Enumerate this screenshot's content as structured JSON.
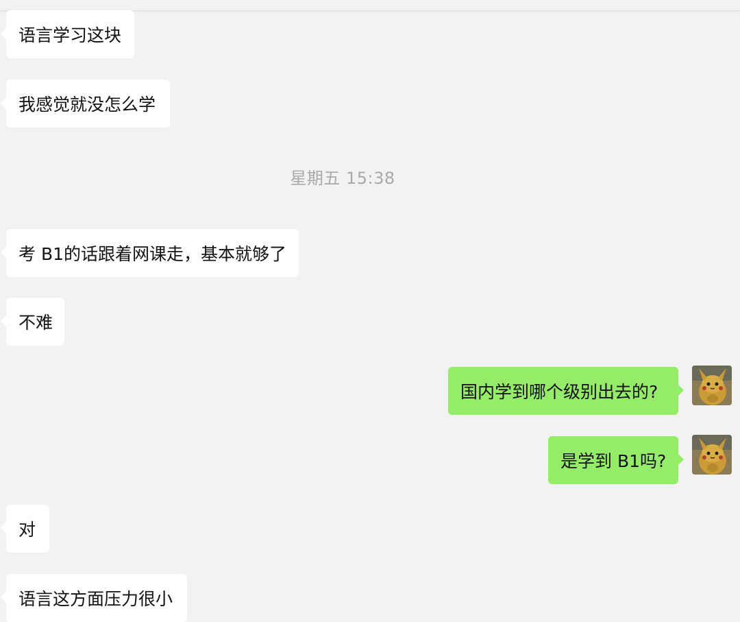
{
  "timestamp": "星期五 15:38",
  "messages": [
    {
      "text": "语言学习这块",
      "from": "other"
    },
    {
      "text": "我感觉就没怎么学",
      "from": "other"
    },
    {
      "text": "考 B1的话跟着网课走，基本就够了",
      "from": "other"
    },
    {
      "text": "不难",
      "from": "other"
    },
    {
      "text": "国内学到哪个级别出去的?",
      "from": "me"
    },
    {
      "text": "是学到 B1吗?",
      "from": "me"
    },
    {
      "text": "对",
      "from": "other"
    },
    {
      "text": "语言这方面压力很小",
      "from": "other"
    }
  ],
  "colors": {
    "background": "#f2f2f2",
    "incoming_bubble": "#ffffff",
    "outgoing_bubble": "#95ec69",
    "timestamp_text": "#a9a9a9"
  },
  "avatar": {
    "icon": "pikachu-avatar-icon"
  }
}
